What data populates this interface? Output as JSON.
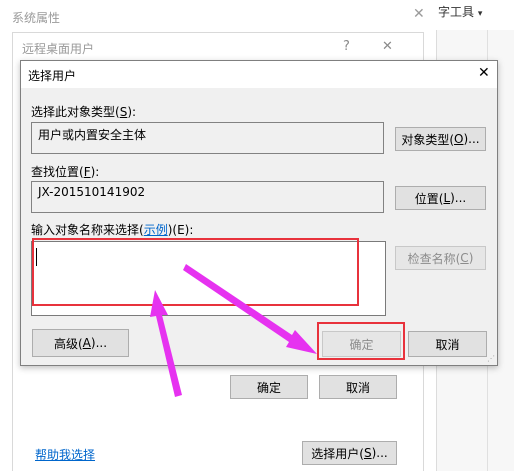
{
  "sys_props": {
    "title": "系统属性",
    "close_glyph": "✕"
  },
  "toolbar_tool": {
    "label": "字工具",
    "arrow_glyph": "▾"
  },
  "remote": {
    "title": "远程桌面用户",
    "help_glyph": "?",
    "close_glyph": "✕",
    "ok_label": "确定",
    "cancel_label": "取消"
  },
  "help_link": "帮助我选择",
  "select_users_btn": {
    "prefix": "选择用户(",
    "key": "S",
    "suffix": ")..."
  },
  "dialog": {
    "title": "选择用户",
    "close_glyph": "✕",
    "type_label": {
      "prefix": "选择此对象类型(",
      "key": "S",
      "suffix": "):"
    },
    "type_value": "用户或内置安全主体",
    "type_btn": {
      "prefix": "对象类型(",
      "key": "O",
      "suffix": ")..."
    },
    "loc_label": {
      "prefix": "查找位置(",
      "key": "F",
      "suffix": "):"
    },
    "loc_value": "JX-201510141902",
    "loc_btn": {
      "prefix": "位置(",
      "key": "L",
      "suffix": ")..."
    },
    "names_label": {
      "prefix": "输入对象名称来选择(",
      "link": "示例",
      "suffix": ")(E):"
    },
    "names_value": "",
    "check_btn": {
      "prefix": "检查名称(",
      "key": "C",
      "suffix": ")"
    },
    "advanced_btn": {
      "prefix": "高级(",
      "key": "A",
      "suffix": ")..."
    },
    "ok_label": "确定",
    "cancel_label": "取消"
  },
  "annotation_colors": {
    "highlight": "#e8323c",
    "arrow": "#e632f0"
  }
}
